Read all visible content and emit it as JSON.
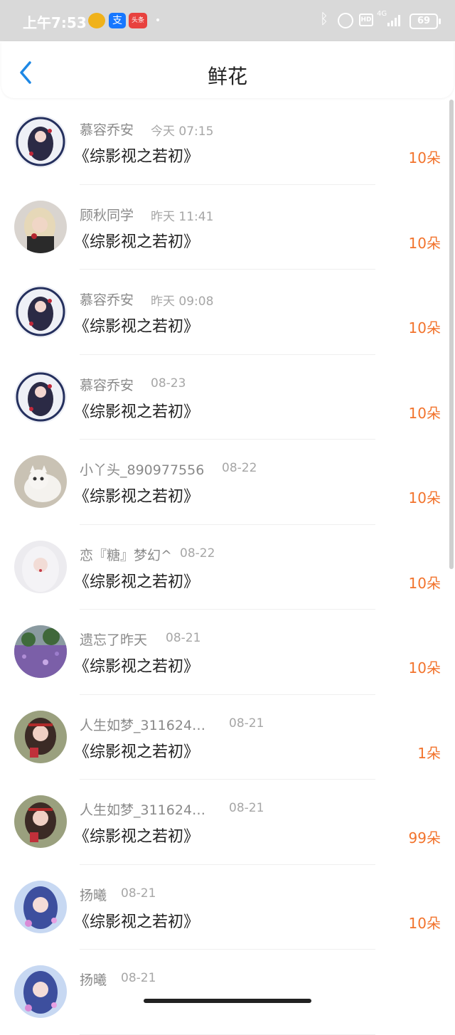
{
  "status_bar": {
    "time": "上午7:53",
    "zhi_glyph": "支",
    "toutiao_label": "头条",
    "network": "4G",
    "hd": "HD",
    "battery": "69"
  },
  "header": {
    "title": "鲜花"
  },
  "colors": {
    "count": "#f2732c",
    "back_arrow": "#1e88e5"
  },
  "rows": [
    {
      "name": "慕容乔安",
      "time": "今天 07:15",
      "book": "《综影视之若初》",
      "count": "10朵",
      "avatar": "birthday-badge"
    },
    {
      "name": "顾秋同学",
      "time": "昨天 11:41",
      "book": "《综影视之若初》",
      "count": "10朵",
      "avatar": "blonde-girl"
    },
    {
      "name": "慕容乔安",
      "time": "昨天 09:08",
      "book": "《综影视之若初》",
      "count": "10朵",
      "avatar": "birthday-badge"
    },
    {
      "name": "慕容乔安",
      "time": "08-23",
      "book": "《综影视之若初》",
      "count": "10朵",
      "avatar": "birthday-badge"
    },
    {
      "name": "小丫头_890977556",
      "time": "08-22",
      "book": "《综影视之若初》",
      "count": "10朵",
      "avatar": "white-cat"
    },
    {
      "name": "恋『糖』梦幻^",
      "time": "08-22",
      "book": "《综影视之若初》",
      "count": "10朵",
      "avatar": "white-hair-girl"
    },
    {
      "name": "遗忘了昨天",
      "time": "08-21",
      "book": "《综影视之若初》",
      "count": "10朵",
      "avatar": "flower-field"
    },
    {
      "name": "人生如梦_311624…",
      "time": "08-21",
      "book": "《综影视之若初》",
      "count": "1朵",
      "avatar": "red-girl"
    },
    {
      "name": "人生如梦_311624…",
      "time": "08-21",
      "book": "《综影视之若初》",
      "count": "99朵",
      "avatar": "red-girl"
    },
    {
      "name": "扬曦",
      "time": "08-21",
      "book": "《综影视之若初》",
      "count": "10朵",
      "avatar": "blue-girl"
    },
    {
      "name": "扬曦",
      "time": "08-21",
      "book": "",
      "count": "",
      "avatar": "blue-girl"
    }
  ]
}
